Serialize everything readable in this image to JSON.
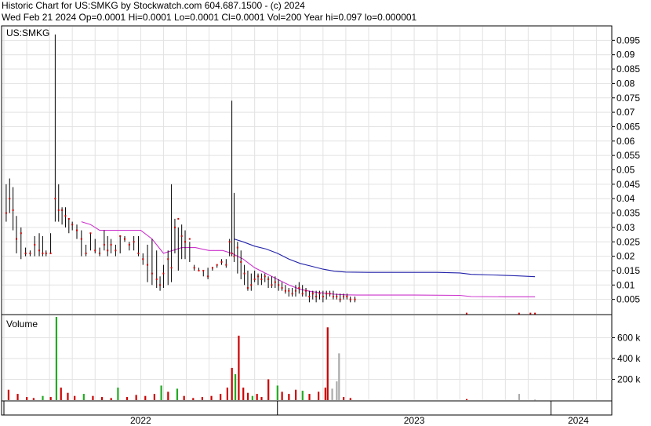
{
  "header": {
    "line1": "Historic Chart for US:SMKG by Stockwatch.com 604.687.1500 - (c) 2024",
    "line2": "Wed Feb 21 2024   Op=0.0001  Hi=0.0001  Lo=0.0001  Cl=0.0001  Vol=200  Year hi=0.097  lo=0.000001"
  },
  "colors": {
    "price_bar": "#000000",
    "close_dot": "#cc0000",
    "ma_short": "#cc33cc",
    "ma_long": "#2222aa",
    "vol_up": "#22aa22",
    "vol_down": "#cc0000",
    "vol_flat": "#aaaaaa",
    "grid": "#e2e2e2"
  },
  "chart_data": [
    {
      "type": "line",
      "title": "US:SMKG",
      "ylabel": "",
      "ylim": [
        0,
        0.1
      ],
      "yticks": [
        "0.005",
        "0.01",
        "0.015",
        "0.02",
        "0.025",
        "0.03",
        "0.035",
        "0.04",
        "0.045",
        "0.05",
        "0.055",
        "0.06",
        "0.065",
        "0.07",
        "0.075",
        "0.08",
        "0.085",
        "0.09",
        "0.095"
      ],
      "x_years": [
        "2022",
        "2023",
        "2024"
      ],
      "x_range_months": [
        0,
        26.6
      ],
      "grid": true,
      "series": [
        {
          "kind": "price",
          "points": [
            [
              0.1,
              0.035,
              0.045,
              0.032
            ],
            [
              0.25,
              0.04,
              0.047,
              0.035
            ],
            [
              0.4,
              0.036,
              0.044,
              0.029
            ],
            [
              0.55,
              0.026,
              0.034,
              0.021
            ],
            [
              0.75,
              0.028,
              0.03,
              0.019
            ],
            [
              0.95,
              0.021,
              0.023,
              0.02
            ],
            [
              1.15,
              0.021,
              0.022,
              0.02
            ],
            [
              1.35,
              0.024,
              0.027,
              0.02
            ],
            [
              1.55,
              0.022,
              0.028,
              0.02
            ],
            [
              1.7,
              0.021,
              0.027,
              0.02
            ],
            [
              1.85,
              0.021,
              0.022,
              0.02
            ],
            [
              2.05,
              0.021,
              0.028,
              0.021
            ],
            [
              2.25,
              0.04,
              0.097,
              0.032
            ],
            [
              2.4,
              0.036,
              0.045,
              0.032
            ],
            [
              2.55,
              0.036,
              0.037,
              0.031
            ],
            [
              2.7,
              0.034,
              0.037,
              0.03
            ],
            [
              2.85,
              0.033,
              0.033,
              0.028
            ],
            [
              3.0,
              0.031,
              0.032,
              0.029
            ],
            [
              3.2,
              0.029,
              0.031,
              0.026
            ],
            [
              3.4,
              0.026,
              0.029,
              0.02
            ],
            [
              3.6,
              0.021,
              0.024,
              0.02
            ],
            [
              3.8,
              0.028,
              0.028,
              0.022
            ],
            [
              4.0,
              0.022,
              0.026,
              0.021
            ],
            [
              4.2,
              0.021,
              0.023,
              0.02
            ],
            [
              4.4,
              0.024,
              0.029,
              0.022
            ],
            [
              4.55,
              0.022,
              0.027,
              0.02
            ],
            [
              4.7,
              0.024,
              0.026,
              0.021
            ],
            [
              4.9,
              0.022,
              0.024,
              0.02
            ],
            [
              5.1,
              0.027,
              0.027,
              0.021
            ],
            [
              5.3,
              0.026,
              0.027,
              0.025
            ],
            [
              5.5,
              0.024,
              0.025,
              0.022
            ],
            [
              5.7,
              0.025,
              0.027,
              0.022
            ],
            [
              5.9,
              0.021,
              0.027,
              0.02
            ],
            [
              6.1,
              0.019,
              0.021,
              0.017
            ],
            [
              6.3,
              0.017,
              0.024,
              0.011
            ],
            [
              6.5,
              0.014,
              0.026,
              0.01
            ],
            [
              6.7,
              0.012,
              0.022,
              0.009
            ],
            [
              6.85,
              0.01,
              0.013,
              0.008
            ],
            [
              7.0,
              0.014,
              0.017,
              0.009
            ],
            [
              7.2,
              0.019,
              0.022,
              0.01
            ],
            [
              7.35,
              0.016,
              0.045,
              0.011
            ],
            [
              7.5,
              0.03,
              0.033,
              0.021
            ],
            [
              7.65,
              0.033,
              0.03,
              0.015
            ],
            [
              7.8,
              0.027,
              0.031,
              0.019
            ],
            [
              7.95,
              0.025,
              0.029,
              0.019
            ],
            [
              8.15,
              0.026,
              0.025,
              0.018
            ],
            [
              8.35,
              0.016,
              0.017,
              0.015
            ],
            [
              8.55,
              0.015,
              0.016,
              0.015
            ],
            [
              8.75,
              0.015,
              0.015,
              0.013
            ],
            [
              8.95,
              0.013,
              0.016,
              0.012
            ],
            [
              9.15,
              0.016,
              0.016,
              0.015
            ],
            [
              9.35,
              0.017,
              0.017,
              0.016
            ],
            [
              9.55,
              0.018,
              0.019,
              0.017
            ],
            [
              9.75,
              0.017,
              0.019,
              0.016
            ],
            [
              9.9,
              0.025,
              0.026,
              0.02
            ],
            [
              10.0,
              0.021,
              0.074,
              0.02
            ],
            [
              10.1,
              0.02,
              0.042,
              0.018
            ],
            [
              10.25,
              0.023,
              0.025,
              0.014
            ],
            [
              10.4,
              0.018,
              0.022,
              0.012
            ],
            [
              10.55,
              0.014,
              0.017,
              0.01
            ],
            [
              10.7,
              0.009,
              0.015,
              0.008
            ],
            [
              10.85,
              0.01,
              0.014,
              0.008
            ],
            [
              11.0,
              0.012,
              0.015,
              0.011
            ],
            [
              11.15,
              0.013,
              0.014,
              0.01
            ],
            [
              11.3,
              0.012,
              0.014,
              0.01
            ],
            [
              11.45,
              0.013,
              0.014,
              0.011
            ],
            [
              11.6,
              0.012,
              0.013,
              0.009
            ],
            [
              11.75,
              0.01,
              0.013,
              0.009
            ],
            [
              11.9,
              0.011,
              0.013,
              0.009
            ],
            [
              12.05,
              0.01,
              0.012,
              0.008
            ],
            [
              12.2,
              0.009,
              0.011,
              0.008
            ],
            [
              12.35,
              0.008,
              0.01,
              0.007
            ],
            [
              12.5,
              0.008,
              0.009,
              0.006
            ],
            [
              12.65,
              0.007,
              0.009,
              0.006
            ],
            [
              12.8,
              0.008,
              0.01,
              0.006
            ],
            [
              12.95,
              0.009,
              0.011,
              0.007
            ],
            [
              13.1,
              0.007,
              0.01,
              0.006
            ],
            [
              13.25,
              0.008,
              0.009,
              0.006
            ],
            [
              13.4,
              0.006,
              0.008,
              0.004
            ],
            [
              13.55,
              0.007,
              0.008,
              0.005
            ],
            [
              13.7,
              0.006,
              0.008,
              0.004
            ],
            [
              13.85,
              0.007,
              0.008,
              0.005
            ],
            [
              14.0,
              0.006,
              0.008,
              0.004
            ],
            [
              14.15,
              0.007,
              0.008,
              0.005
            ],
            [
              14.3,
              0.007,
              0.008,
              0.006
            ],
            [
              14.45,
              0.006,
              0.008,
              0.005
            ],
            [
              14.6,
              0.006,
              0.007,
              0.005
            ],
            [
              14.75,
              0.005,
              0.007,
              0.004
            ],
            [
              14.9,
              0.006,
              0.007,
              0.005
            ],
            [
              15.05,
              0.006,
              0.007,
              0.005
            ],
            [
              15.2,
              0.005,
              0.006,
              0.004
            ],
            [
              15.4,
              0.005,
              0.006,
              0.004
            ],
            [
              20.3,
              0.0001,
              0.0001,
              0.0001
            ],
            [
              22.6,
              0.0001,
              0.0001,
              0.0001
            ],
            [
              23.1,
              0.0001,
              0.0001,
              0.0001
            ],
            [
              23.3,
              0.0001,
              0.0001,
              0.0001
            ]
          ]
        },
        {
          "kind": "ma_short",
          "points": [
            [
              3.4,
              0.032
            ],
            [
              3.8,
              0.031
            ],
            [
              4.2,
              0.029
            ],
            [
              5.0,
              0.029
            ],
            [
              6.0,
              0.029
            ],
            [
              6.5,
              0.026
            ],
            [
              7.0,
              0.021
            ],
            [
              7.4,
              0.022
            ],
            [
              7.8,
              0.023
            ],
            [
              8.4,
              0.023
            ],
            [
              9.0,
              0.022
            ],
            [
              9.6,
              0.022
            ],
            [
              10.0,
              0.021
            ],
            [
              10.5,
              0.019
            ],
            [
              11.0,
              0.016
            ],
            [
              11.5,
              0.014
            ],
            [
              12.0,
              0.012
            ],
            [
              12.5,
              0.01
            ],
            [
              13.0,
              0.0085
            ],
            [
              13.5,
              0.0077
            ],
            [
              14.0,
              0.0072
            ],
            [
              14.5,
              0.0068
            ],
            [
              15.0,
              0.0066
            ],
            [
              15.5,
              0.0065
            ],
            [
              16.5,
              0.0065
            ],
            [
              18.0,
              0.0065
            ],
            [
              20.0,
              0.0064
            ],
            [
              20.5,
              0.006
            ],
            [
              22.0,
              0.0059
            ],
            [
              23.3,
              0.0059
            ]
          ]
        },
        {
          "kind": "ma_long",
          "points": [
            [
              10.1,
              0.026
            ],
            [
              10.5,
              0.025
            ],
            [
              11.0,
              0.0235
            ],
            [
              11.5,
              0.0225
            ],
            [
              12.0,
              0.021
            ],
            [
              12.5,
              0.019
            ],
            [
              13.0,
              0.0175
            ],
            [
              13.5,
              0.0165
            ],
            [
              14.0,
              0.0155
            ],
            [
              14.5,
              0.0148
            ],
            [
              15.0,
              0.0145
            ],
            [
              16.0,
              0.0144
            ],
            [
              17.0,
              0.0144
            ],
            [
              18.0,
              0.0144
            ],
            [
              19.0,
              0.0144
            ],
            [
              20.0,
              0.0142
            ],
            [
              20.5,
              0.0137
            ],
            [
              21.5,
              0.0135
            ],
            [
              22.5,
              0.0132
            ],
            [
              23.3,
              0.0129
            ]
          ]
        }
      ]
    },
    {
      "type": "bar",
      "title": "Volume",
      "ylabel": "",
      "ylim": [
        0,
        800000
      ],
      "yticks": [
        "200 k",
        "400 k",
        "600 k"
      ],
      "values": [
        [
          0.2,
          100000,
          "down"
        ],
        [
          0.6,
          60000,
          "down"
        ],
        [
          1.0,
          30000,
          "down"
        ],
        [
          1.3,
          20000,
          "down"
        ],
        [
          1.7,
          40000,
          "up"
        ],
        [
          2.05,
          30000,
          "down"
        ],
        [
          2.3,
          800000,
          "up"
        ],
        [
          2.5,
          120000,
          "down"
        ],
        [
          2.8,
          70000,
          "down"
        ],
        [
          3.1,
          40000,
          "down"
        ],
        [
          3.5,
          60000,
          "up"
        ],
        [
          3.9,
          40000,
          "down"
        ],
        [
          4.3,
          30000,
          "down"
        ],
        [
          4.7,
          20000,
          "down"
        ],
        [
          5.0,
          120000,
          "up"
        ],
        [
          5.4,
          30000,
          "down"
        ],
        [
          5.8,
          50000,
          "down"
        ],
        [
          6.2,
          40000,
          "down"
        ],
        [
          6.6,
          60000,
          "down"
        ],
        [
          6.9,
          140000,
          "up"
        ],
        [
          7.2,
          80000,
          "down"
        ],
        [
          7.6,
          110000,
          "up"
        ],
        [
          7.9,
          40000,
          "down"
        ],
        [
          8.3,
          20000,
          "down"
        ],
        [
          8.7,
          30000,
          "down"
        ],
        [
          9.1,
          40000,
          "down"
        ],
        [
          9.5,
          60000,
          "down"
        ],
        [
          9.8,
          120000,
          "down"
        ],
        [
          10.0,
          310000,
          "down"
        ],
        [
          10.15,
          250000,
          "up"
        ],
        [
          10.3,
          620000,
          "down"
        ],
        [
          10.5,
          120000,
          "down"
        ],
        [
          10.7,
          70000,
          "down"
        ],
        [
          10.9,
          40000,
          "up"
        ],
        [
          11.1,
          60000,
          "down"
        ],
        [
          11.3,
          30000,
          "down"
        ],
        [
          11.6,
          200000,
          "down"
        ],
        [
          12.0,
          140000,
          "up"
        ],
        [
          12.2,
          80000,
          "down"
        ],
        [
          12.5,
          60000,
          "down"
        ],
        [
          12.8,
          100000,
          "down"
        ],
        [
          13.1,
          90000,
          "up"
        ],
        [
          13.4,
          60000,
          "down"
        ],
        [
          13.8,
          80000,
          "down"
        ],
        [
          14.1,
          120000,
          "down"
        ],
        [
          14.2,
          700000,
          "down"
        ],
        [
          14.4,
          110000,
          "flat"
        ],
        [
          14.6,
          180000,
          "flat"
        ],
        [
          14.7,
          450000,
          "flat"
        ],
        [
          14.9,
          30000,
          "down"
        ],
        [
          15.2,
          20000,
          "down"
        ],
        [
          20.3,
          10000,
          "down"
        ],
        [
          22.6,
          60000,
          "flat"
        ],
        [
          23.3,
          5000,
          "flat"
        ]
      ]
    }
  ]
}
